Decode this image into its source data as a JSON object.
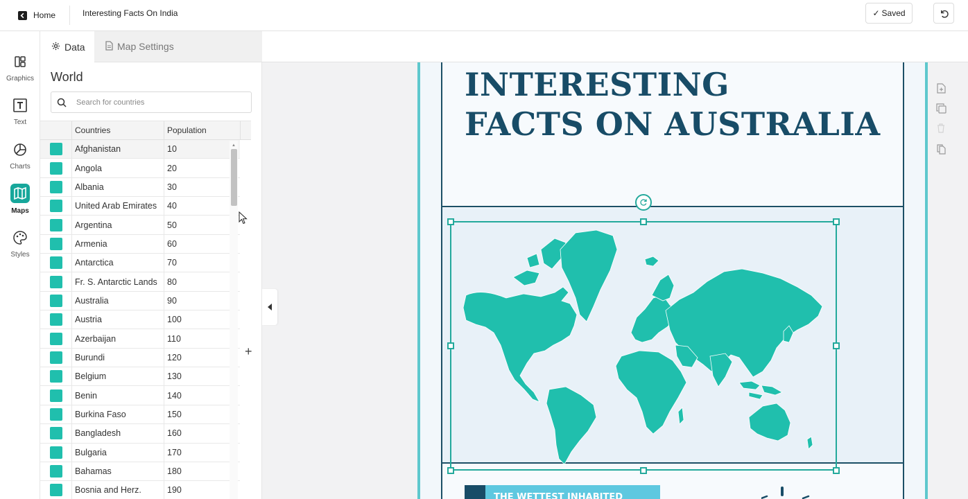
{
  "topbar": {
    "home_label": "Home",
    "doc_title": "Interesting Facts On India",
    "saved_label": "Saved",
    "saved_icon": "checkmark"
  },
  "rail": {
    "items": [
      {
        "label": "Graphics",
        "icon": "graphics-icon"
      },
      {
        "label": "Text",
        "icon": "text-icon"
      },
      {
        "label": "Charts",
        "icon": "pie-chart-icon"
      },
      {
        "label": "Maps",
        "icon": "map-icon",
        "active": true
      },
      {
        "label": "Styles",
        "icon": "palette-icon"
      }
    ]
  },
  "panel": {
    "tabs": [
      {
        "label": "Data",
        "icon": "gear-icon",
        "active": true
      },
      {
        "label": "Map Settings",
        "icon": "document-icon"
      }
    ],
    "title": "World",
    "search_placeholder": "Search for countries",
    "columns": [
      "Countries",
      "Population"
    ],
    "swatch_color": "#20bfad",
    "rows": [
      {
        "country": "Afghanistan",
        "value": "10"
      },
      {
        "country": "Angola",
        "value": "20"
      },
      {
        "country": "Albania",
        "value": "30"
      },
      {
        "country": "United Arab Emirates",
        "value": "40"
      },
      {
        "country": "Argentina",
        "value": "50"
      },
      {
        "country": "Armenia",
        "value": "60"
      },
      {
        "country": "Antarctica",
        "value": "70"
      },
      {
        "country": "Fr. S. Antarctic Lands",
        "value": "80"
      },
      {
        "country": "Australia",
        "value": "90"
      },
      {
        "country": "Austria",
        "value": "100"
      },
      {
        "country": "Azerbaijan",
        "value": "110"
      },
      {
        "country": "Burundi",
        "value": "120"
      },
      {
        "country": "Belgium",
        "value": "130"
      },
      {
        "country": "Benin",
        "value": "140"
      },
      {
        "country": "Burkina Faso",
        "value": "150"
      },
      {
        "country": "Bangladesh",
        "value": "160"
      },
      {
        "country": "Bulgaria",
        "value": "170"
      },
      {
        "country": "Bahamas",
        "value": "180"
      },
      {
        "country": "Bosnia and Herz.",
        "value": "190"
      }
    ],
    "add_column_label": "+"
  },
  "canvas": {
    "headline_line1": "INTERESTING",
    "headline_line2": "FACTS ON AUSTRALIA",
    "headline_color": "#184c67",
    "map_color": "#20bfad",
    "accent_color": "#5ec8cd",
    "banner_text": "THE WETTEST INHABITED"
  },
  "tools": [
    "add-page-icon",
    "duplicate-icon",
    "delete-icon",
    "copy-icon"
  ]
}
